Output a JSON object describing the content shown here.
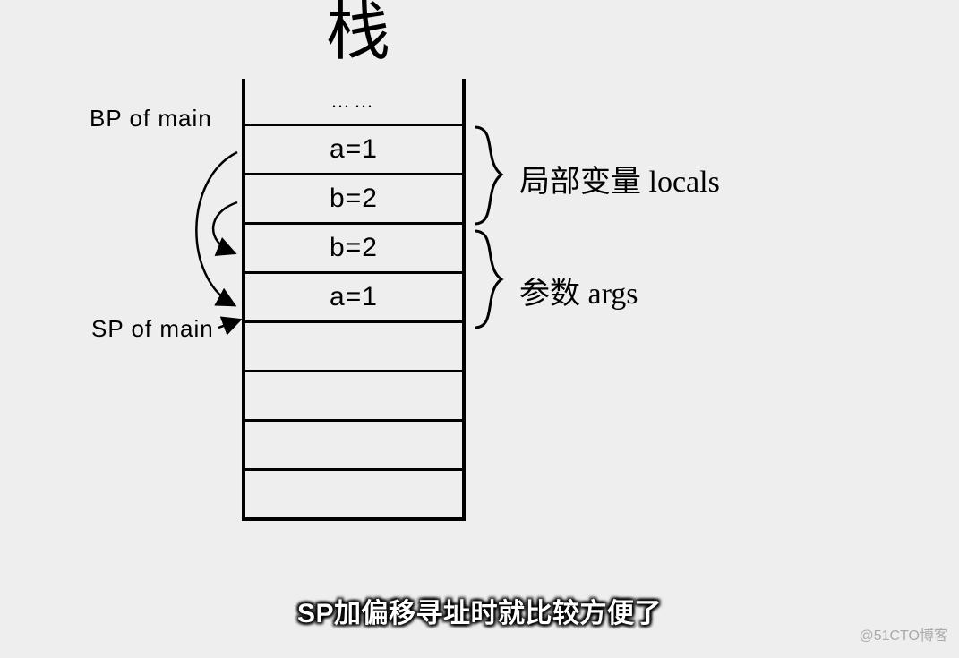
{
  "title": "栈",
  "stack": {
    "cells": [
      {
        "text": "……",
        "kind": "top"
      },
      {
        "text": "a=1",
        "kind": "data"
      },
      {
        "text": "b=2",
        "kind": "data"
      },
      {
        "text": "b=2",
        "kind": "data"
      },
      {
        "text": "a=1",
        "kind": "data"
      },
      {
        "text": "",
        "kind": "empty"
      },
      {
        "text": "",
        "kind": "empty"
      },
      {
        "text": "",
        "kind": "empty"
      },
      {
        "text": "",
        "kind": "empty"
      }
    ]
  },
  "pointers": {
    "bp": "BP of main",
    "sp": "SP of main"
  },
  "groups": {
    "locals": "局部变量 locals",
    "args": "参数 args"
  },
  "subtitle": "SP加偏移寻址时就比较方便了",
  "watermark": "@51CTO博客"
}
